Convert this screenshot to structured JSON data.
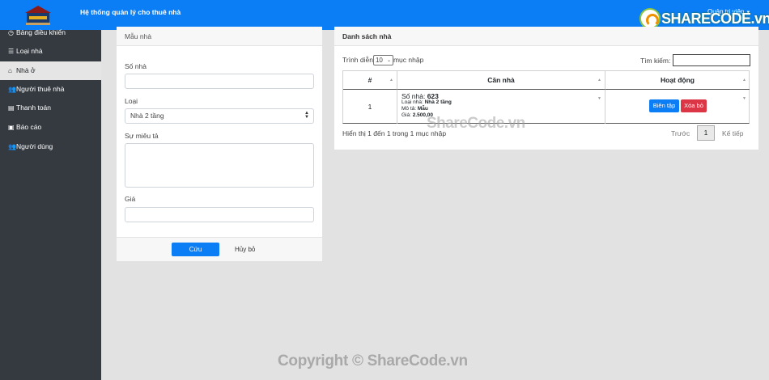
{
  "header": {
    "app_title": "Hệ thống quản lý cho thuê nhà",
    "user_menu": "Quản trị viên",
    "brand_watermark": "SHARECODE.vn"
  },
  "sidebar": {
    "items": [
      {
        "label": "Bảng điều khiển",
        "icon": "dashboard-icon"
      },
      {
        "label": "Loại nhà",
        "icon": "list-icon"
      },
      {
        "label": "Nhà ở",
        "icon": "home-icon",
        "active": true
      },
      {
        "label": "Người thuê nhà",
        "icon": "users-icon"
      },
      {
        "label": "Thanh toán",
        "icon": "file-icon"
      },
      {
        "label": "Báo cáo",
        "icon": "report-icon"
      },
      {
        "label": "Người dùng",
        "icon": "users-icon"
      }
    ]
  },
  "form": {
    "title": "Mẫu nhà",
    "house_no_label": "Số nhà",
    "house_no_value": "",
    "type_label": "Loại",
    "type_value": "Nhà 2 tầng",
    "description_label": "Sự miêu tả",
    "description_value": "",
    "price_label": "Giá",
    "price_value": "",
    "save_label": "Cứu",
    "cancel_label": "Hủy bỏ"
  },
  "list": {
    "title": "Danh sách nhà",
    "show_prefix": "Trình diễn",
    "page_size": "10",
    "show_suffix": "mục nhập",
    "search_label": "Tìm kiếm:",
    "columns": [
      "#",
      "Căn nhà",
      "Hoạt động"
    ],
    "rows": [
      {
        "index": "1",
        "house_no_label": "Số nhà:",
        "house_no": "623",
        "type_label": "Loại nhà:",
        "type": "Nhà 2 tầng",
        "desc_label": "Mô tả:",
        "desc": "Mẫu",
        "price_label": "Giá:",
        "price": "2.500,00",
        "edit_label": "Biên tập",
        "delete_label": "Xóa bỏ"
      }
    ],
    "info": "Hiển thị 1 đến 1 trong 1 mục nhập",
    "prev": "Trước",
    "page": "1",
    "next": "Kế tiếp"
  },
  "watermarks": {
    "middle": "ShareCode.vn",
    "bottom": "Copyright © ShareCode.vn"
  },
  "colors": {
    "primary": "#0b7df5",
    "danger": "#dc3545",
    "sidebar": "#343a40"
  }
}
